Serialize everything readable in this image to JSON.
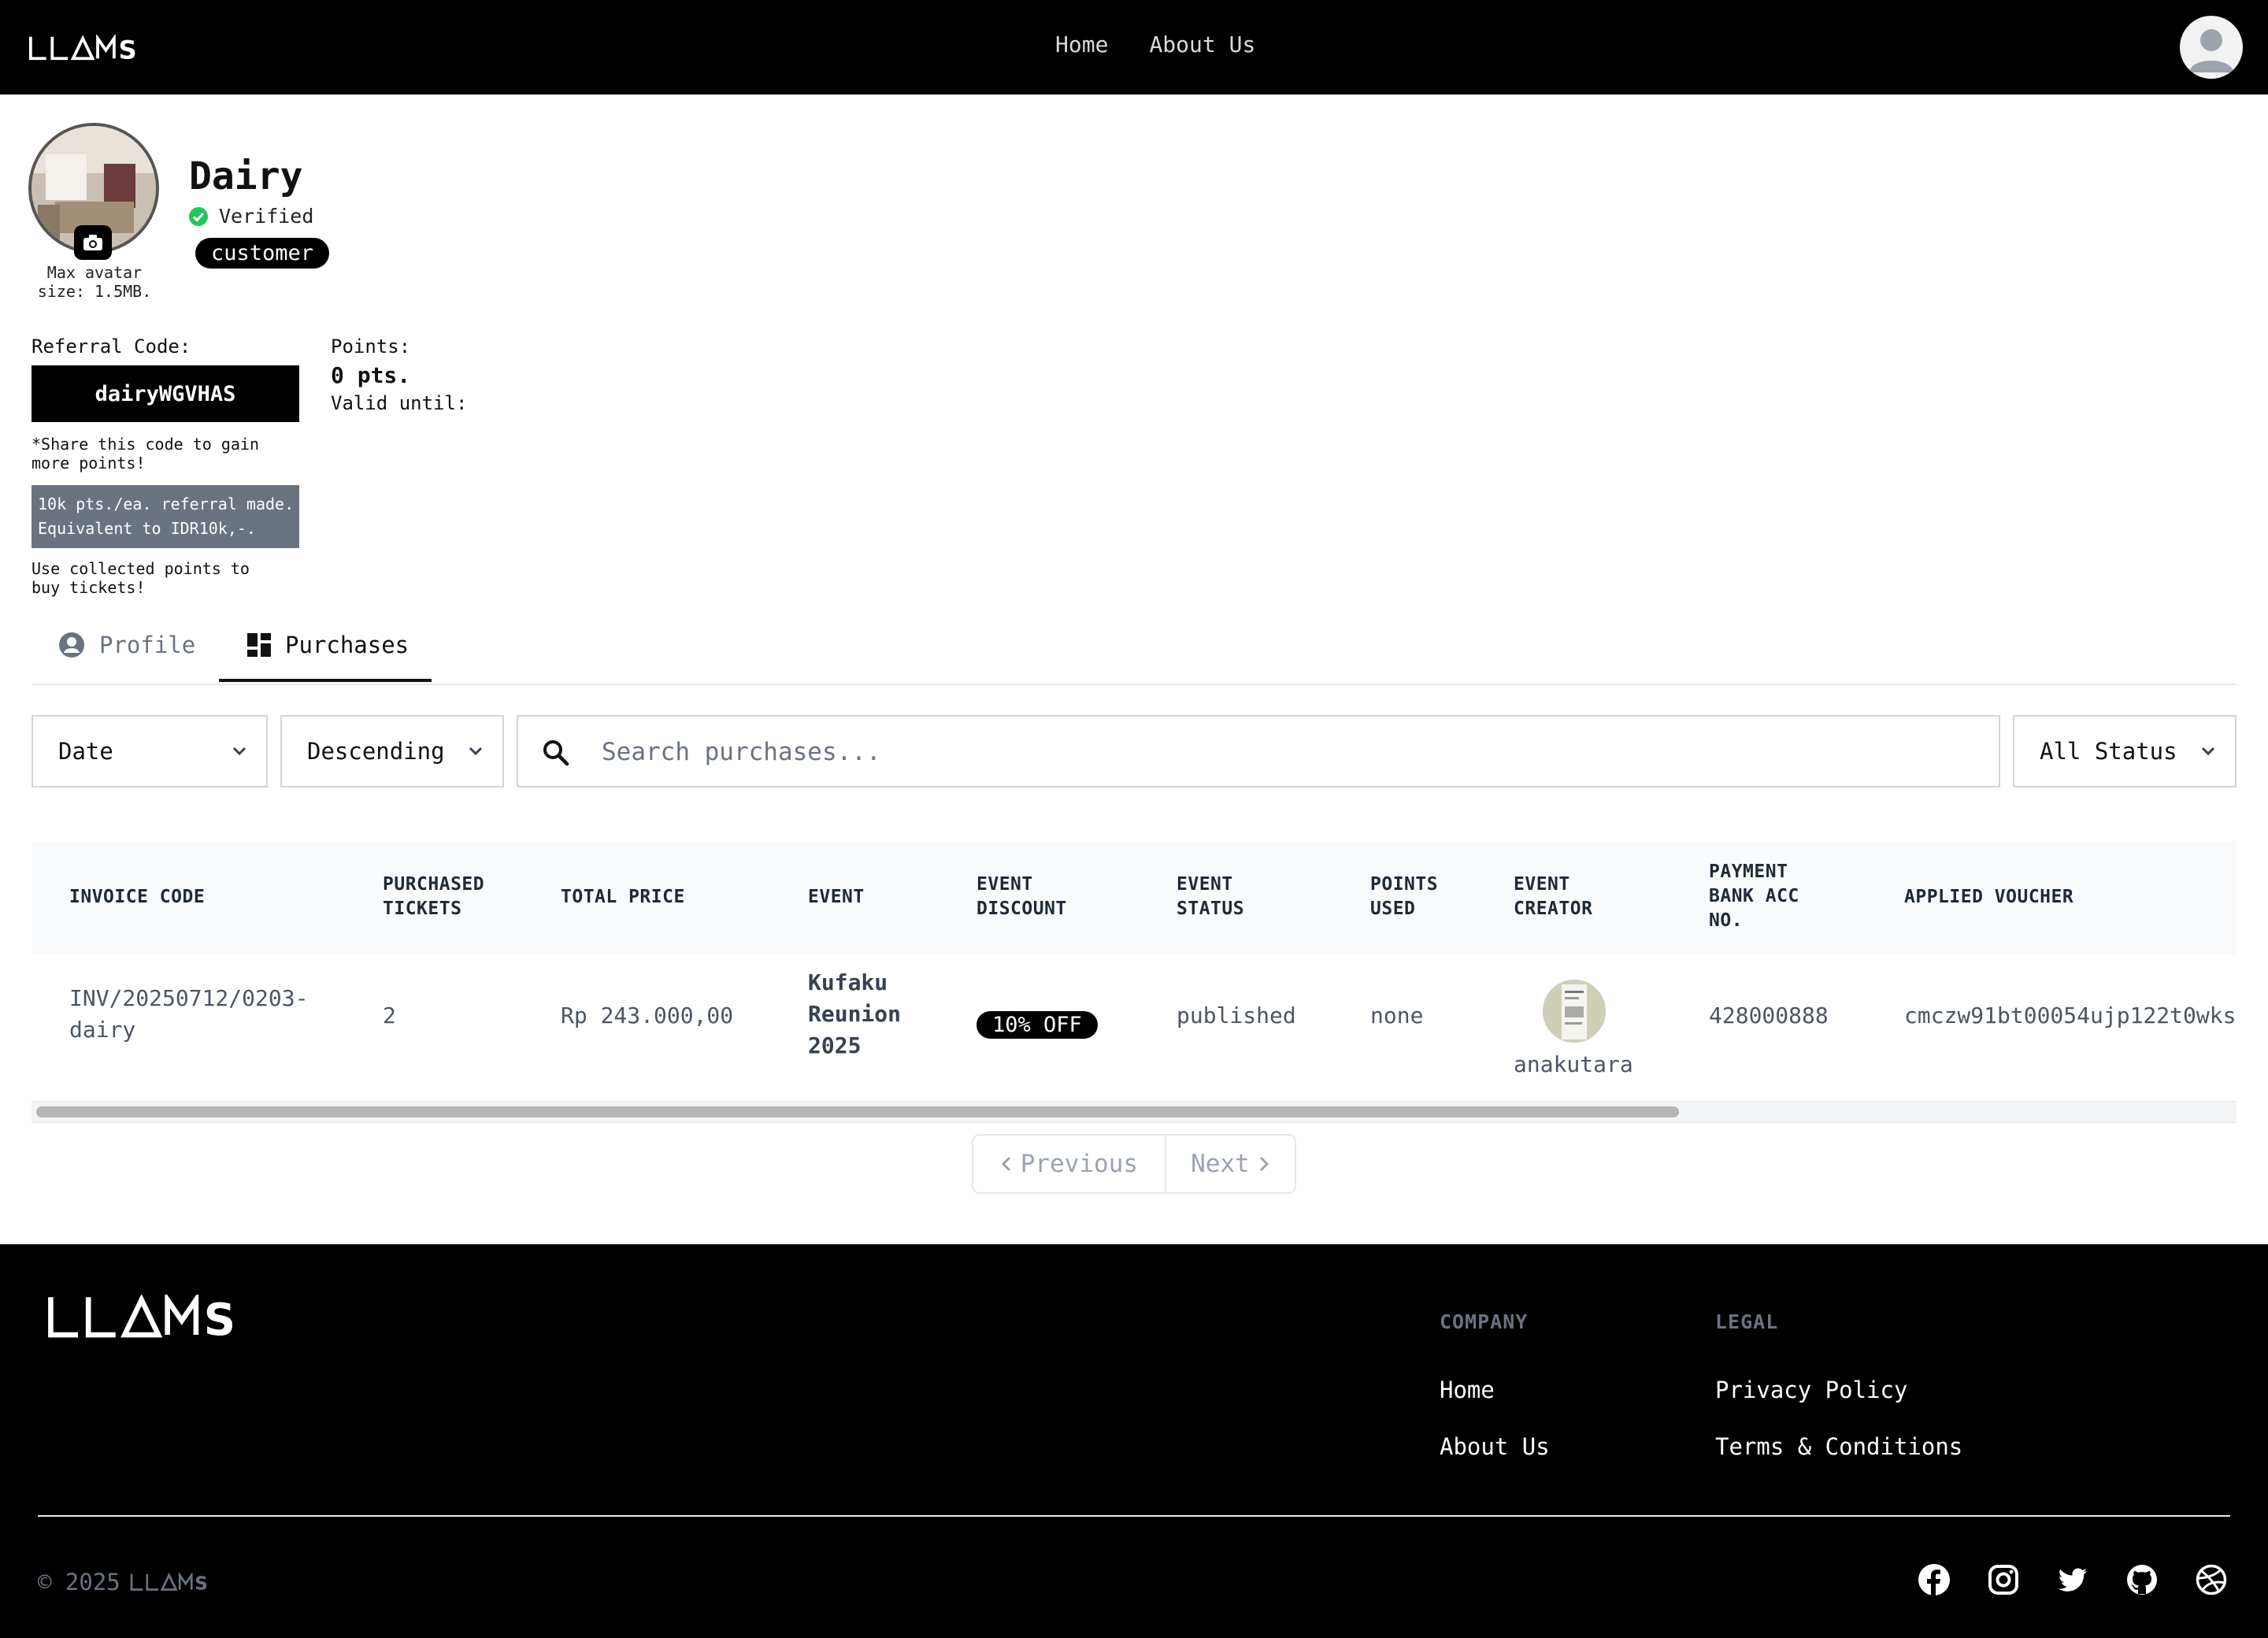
{
  "header": {
    "brand": "LLAMS",
    "nav": [
      {
        "label": "Home"
      },
      {
        "label": "About Us"
      }
    ]
  },
  "profile": {
    "name": "Dairy",
    "verified_label": "Verified",
    "role": "customer",
    "avatar_note": "Max avatar size: 1.5MB.",
    "referral_label": "Referral Code:",
    "referral_code": "dairyWGVHAS",
    "share_note": "*Share this code to gain more points!",
    "referral_info_line1": "10k pts./ea. referral made.",
    "referral_info_line2": "Equivalent to IDR10k,-.",
    "use_note": "Use collected points to buy tickets!",
    "points_label": "Points:",
    "points_value": "0 pts.",
    "valid_until_label": "Valid until:"
  },
  "tabs": [
    {
      "label": "Profile",
      "icon": "user-circle-icon"
    },
    {
      "label": "Purchases",
      "icon": "dashboard-icon",
      "active": true
    }
  ],
  "filters": {
    "sort_by": "Date",
    "order": "Descending",
    "search_placeholder": "Search purchases...",
    "status": "All Status"
  },
  "table": {
    "columns": [
      "INVOICE CODE",
      "PURCHASED TICKETS",
      "TOTAL PRICE",
      "EVENT",
      "EVENT DISCOUNT",
      "EVENT STATUS",
      "POINTS USED",
      "EVENT CREATOR",
      "PAYMENT BANK ACC NO.",
      "APPLIED VOUCHER"
    ],
    "rows": [
      {
        "invoice_code": "INV/20250712/0203-dairy",
        "purchased_tickets": "2",
        "total_price": "Rp 243.000,00",
        "event": "Kufaku Reunion 2025",
        "event_discount": "10% OFF",
        "event_status": "published",
        "points_used": "none",
        "event_creator": "anakutara",
        "payment_bank_acc_no": "428000888",
        "applied_voucher": "cmczw91bt00054ujp122t0wks"
      }
    ]
  },
  "pagination": {
    "previous": "Previous",
    "next": "Next"
  },
  "footer": {
    "brand": "LLAMS",
    "company_heading": "COMPANY",
    "company_links": [
      "Home",
      "About Us"
    ],
    "legal_heading": "LEGAL",
    "legal_links": [
      "Privacy Policy",
      "Terms & Conditions"
    ],
    "copyright": "© 2025",
    "socials": [
      "facebook-icon",
      "instagram-icon",
      "twitter-icon",
      "github-icon",
      "dribbble-icon"
    ]
  },
  "colors": {
    "header_bg": "#000000",
    "verified_green": "#22c55e",
    "info_box_bg": "#6b7280"
  }
}
